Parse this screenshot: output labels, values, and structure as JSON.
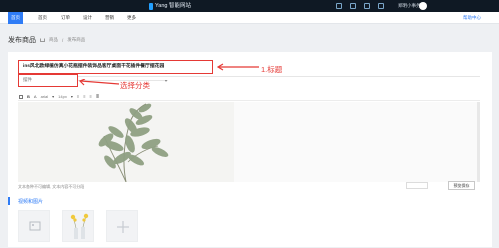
{
  "topbar": {
    "logo_text": "Yang 智能网站",
    "user_name": "郑明小事务"
  },
  "navbar": {
    "items": [
      {
        "label": "首页",
        "active": true
      },
      {
        "label": "首页"
      },
      {
        "label": "订单"
      },
      {
        "label": "设计"
      },
      {
        "label": "营销"
      },
      {
        "label": "更多"
      }
    ],
    "help": "帮助中心"
  },
  "page": {
    "title": "发布商品",
    "breadcrumb": [
      "商品",
      "发布商品"
    ]
  },
  "form": {
    "title_value": "ins风北欧绿植仿真小花瓶摆件装饰品客厅桌面干花插件餐厅摆花园",
    "category_value": "摆件",
    "editor": {
      "font_select": "arial",
      "size_select": "14px",
      "footer_note": "文本各种不可编辑, 文本内容不可分段",
      "dropdown_value": "",
      "save_label": "预览保存"
    }
  },
  "annotations": {
    "title_label": "1.标题",
    "category_label": "选择分类",
    "color": "#e53935"
  },
  "images_section": {
    "title": "视频和图片"
  },
  "colors": {
    "accent": "#2f7cf6",
    "topbar": "#0f1924",
    "annotation": "#e53935"
  }
}
